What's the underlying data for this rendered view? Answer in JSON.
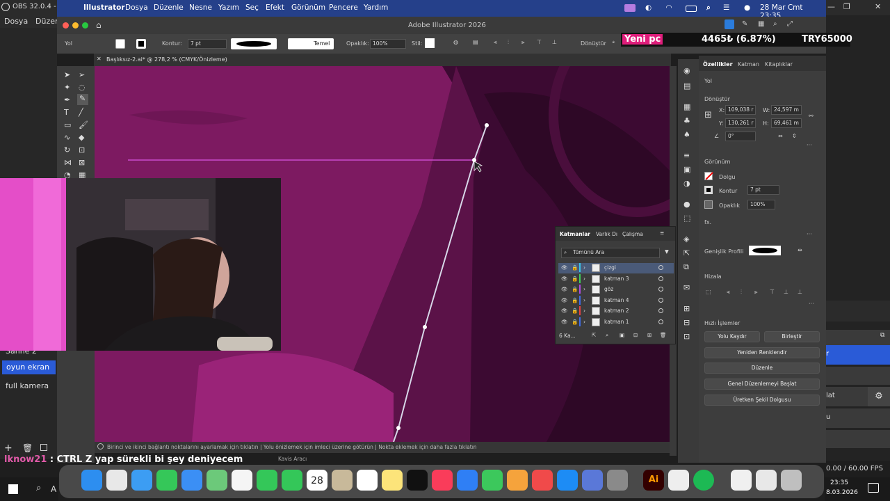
{
  "obs": {
    "title": "OBS 32.0.4 - Pr",
    "menu": [
      "Dosya",
      "Düzen"
    ],
    "scenes": [
      "Sahne 2",
      "oyun ekran",
      "full kamera"
    ],
    "fps": "0.00 / 60.00 FPS",
    "right_labels": [
      "r",
      "lat",
      "u"
    ]
  },
  "mac": {
    "apple": "",
    "app": "Illustrator",
    "menu": [
      "Dosya",
      "Düzenle",
      "Nesne",
      "Yazım",
      "Seç",
      "Efekt",
      "Görünüm",
      "Pencere",
      "Yardım"
    ],
    "datetime": "28 Mar Cmt  23:35"
  },
  "ai": {
    "window_title": "Adobe Illustrator 2026",
    "tool_label": "Yol",
    "kontur_label": "Kontur:",
    "stroke_value": "7 pt",
    "stroke_style": "Temel",
    "opacity_label": "Opaklık:",
    "opacity_value": "100%",
    "style_label": "Stil:",
    "transform_label": "Dönüştür",
    "doc_tab": "Başlıksız-2.ai* @ 278,2 % (CMYK/Önizleme)",
    "status_text": "Birinci ve ikinci bağlantı noktalarını ayarlamak için tıklatın  |  Yolu önizlemek için imleci üzerine götürün  |  Nokta eklemek için daha fazla tıklatın",
    "status_tool": "Kavis Aracı"
  },
  "overlay": {
    "badge": "Yeni pc",
    "price": "4465₺ (6.87%)",
    "goal": "TRY65000"
  },
  "props": {
    "tabs": [
      "Özellikler",
      "Katman",
      "Kitaplıklar"
    ],
    "type": "Yol",
    "transform_title": "Dönüştür",
    "x": "109,038 r",
    "w": "24,597 m",
    "y": "130,261 r",
    "h": "69,461 m",
    "angle": "0°",
    "appearance_title": "Görünüm",
    "fill_label": "Dolgu",
    "stroke_label": "Kontur",
    "stroke_value": "7 pt",
    "opacity_label": "Opaklık",
    "opacity_value": "100%",
    "fx": "fx.",
    "width_profile": "Genişlik Profili",
    "align": "Hizala",
    "quick": "Hızlı İşlemler",
    "btn_outline": "Yolu Kaydır",
    "btn_merge": "Birleştir",
    "btn_recolor": "Yeniden Renklendir",
    "btn_edit": "Düzenle",
    "btn_global": "Genel Düzenlemeyi Başlat",
    "btn_gen": "Üretken Şekil Dolgusu"
  },
  "layers": {
    "tabs": [
      "Katmanlar",
      "Varlık Dı",
      "Çalışma"
    ],
    "search": "Tümünü Ara",
    "rows": [
      {
        "name": "çizgi",
        "color": "#39c4e8"
      },
      {
        "name": "katman 3",
        "color": "#3fcf5a"
      },
      {
        "name": "göz",
        "color": "#b04be0"
      },
      {
        "name": "katman 4",
        "color": "#3f6de8"
      },
      {
        "name": "katman 2",
        "color": "#e84040"
      },
      {
        "name": "katman 1",
        "color": "#3f6de8"
      }
    ],
    "count": "6 Ka..."
  },
  "chat": {
    "user": "lknow21",
    "message": " : CTRL Z yap sürekli bi şey deniyecem"
  },
  "taskbar": {
    "time": "23:35",
    "date": "8.03.2026",
    "search": "A"
  },
  "dock": {
    "calendar_day": "28"
  }
}
